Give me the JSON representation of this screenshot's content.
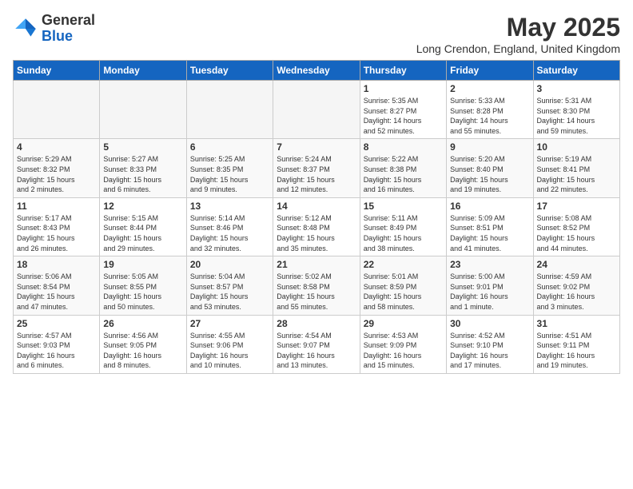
{
  "header": {
    "logo_general": "General",
    "logo_blue": "Blue",
    "month_title": "May 2025",
    "location": "Long Crendon, England, United Kingdom"
  },
  "weekdays": [
    "Sunday",
    "Monday",
    "Tuesday",
    "Wednesday",
    "Thursday",
    "Friday",
    "Saturday"
  ],
  "weeks": [
    [
      {
        "day": "",
        "info": ""
      },
      {
        "day": "",
        "info": ""
      },
      {
        "day": "",
        "info": ""
      },
      {
        "day": "",
        "info": ""
      },
      {
        "day": "1",
        "info": "Sunrise: 5:35 AM\nSunset: 8:27 PM\nDaylight: 14 hours\nand 52 minutes."
      },
      {
        "day": "2",
        "info": "Sunrise: 5:33 AM\nSunset: 8:28 PM\nDaylight: 14 hours\nand 55 minutes."
      },
      {
        "day": "3",
        "info": "Sunrise: 5:31 AM\nSunset: 8:30 PM\nDaylight: 14 hours\nand 59 minutes."
      }
    ],
    [
      {
        "day": "4",
        "info": "Sunrise: 5:29 AM\nSunset: 8:32 PM\nDaylight: 15 hours\nand 2 minutes."
      },
      {
        "day": "5",
        "info": "Sunrise: 5:27 AM\nSunset: 8:33 PM\nDaylight: 15 hours\nand 6 minutes."
      },
      {
        "day": "6",
        "info": "Sunrise: 5:25 AM\nSunset: 8:35 PM\nDaylight: 15 hours\nand 9 minutes."
      },
      {
        "day": "7",
        "info": "Sunrise: 5:24 AM\nSunset: 8:37 PM\nDaylight: 15 hours\nand 12 minutes."
      },
      {
        "day": "8",
        "info": "Sunrise: 5:22 AM\nSunset: 8:38 PM\nDaylight: 15 hours\nand 16 minutes."
      },
      {
        "day": "9",
        "info": "Sunrise: 5:20 AM\nSunset: 8:40 PM\nDaylight: 15 hours\nand 19 minutes."
      },
      {
        "day": "10",
        "info": "Sunrise: 5:19 AM\nSunset: 8:41 PM\nDaylight: 15 hours\nand 22 minutes."
      }
    ],
    [
      {
        "day": "11",
        "info": "Sunrise: 5:17 AM\nSunset: 8:43 PM\nDaylight: 15 hours\nand 26 minutes."
      },
      {
        "day": "12",
        "info": "Sunrise: 5:15 AM\nSunset: 8:44 PM\nDaylight: 15 hours\nand 29 minutes."
      },
      {
        "day": "13",
        "info": "Sunrise: 5:14 AM\nSunset: 8:46 PM\nDaylight: 15 hours\nand 32 minutes."
      },
      {
        "day": "14",
        "info": "Sunrise: 5:12 AM\nSunset: 8:48 PM\nDaylight: 15 hours\nand 35 minutes."
      },
      {
        "day": "15",
        "info": "Sunrise: 5:11 AM\nSunset: 8:49 PM\nDaylight: 15 hours\nand 38 minutes."
      },
      {
        "day": "16",
        "info": "Sunrise: 5:09 AM\nSunset: 8:51 PM\nDaylight: 15 hours\nand 41 minutes."
      },
      {
        "day": "17",
        "info": "Sunrise: 5:08 AM\nSunset: 8:52 PM\nDaylight: 15 hours\nand 44 minutes."
      }
    ],
    [
      {
        "day": "18",
        "info": "Sunrise: 5:06 AM\nSunset: 8:54 PM\nDaylight: 15 hours\nand 47 minutes."
      },
      {
        "day": "19",
        "info": "Sunrise: 5:05 AM\nSunset: 8:55 PM\nDaylight: 15 hours\nand 50 minutes."
      },
      {
        "day": "20",
        "info": "Sunrise: 5:04 AM\nSunset: 8:57 PM\nDaylight: 15 hours\nand 53 minutes."
      },
      {
        "day": "21",
        "info": "Sunrise: 5:02 AM\nSunset: 8:58 PM\nDaylight: 15 hours\nand 55 minutes."
      },
      {
        "day": "22",
        "info": "Sunrise: 5:01 AM\nSunset: 8:59 PM\nDaylight: 15 hours\nand 58 minutes."
      },
      {
        "day": "23",
        "info": "Sunrise: 5:00 AM\nSunset: 9:01 PM\nDaylight: 16 hours\nand 1 minute."
      },
      {
        "day": "24",
        "info": "Sunrise: 4:59 AM\nSunset: 9:02 PM\nDaylight: 16 hours\nand 3 minutes."
      }
    ],
    [
      {
        "day": "25",
        "info": "Sunrise: 4:57 AM\nSunset: 9:03 PM\nDaylight: 16 hours\nand 6 minutes."
      },
      {
        "day": "26",
        "info": "Sunrise: 4:56 AM\nSunset: 9:05 PM\nDaylight: 16 hours\nand 8 minutes."
      },
      {
        "day": "27",
        "info": "Sunrise: 4:55 AM\nSunset: 9:06 PM\nDaylight: 16 hours\nand 10 minutes."
      },
      {
        "day": "28",
        "info": "Sunrise: 4:54 AM\nSunset: 9:07 PM\nDaylight: 16 hours\nand 13 minutes."
      },
      {
        "day": "29",
        "info": "Sunrise: 4:53 AM\nSunset: 9:09 PM\nDaylight: 16 hours\nand 15 minutes."
      },
      {
        "day": "30",
        "info": "Sunrise: 4:52 AM\nSunset: 9:10 PM\nDaylight: 16 hours\nand 17 minutes."
      },
      {
        "day": "31",
        "info": "Sunrise: 4:51 AM\nSunset: 9:11 PM\nDaylight: 16 hours\nand 19 minutes."
      }
    ]
  ]
}
